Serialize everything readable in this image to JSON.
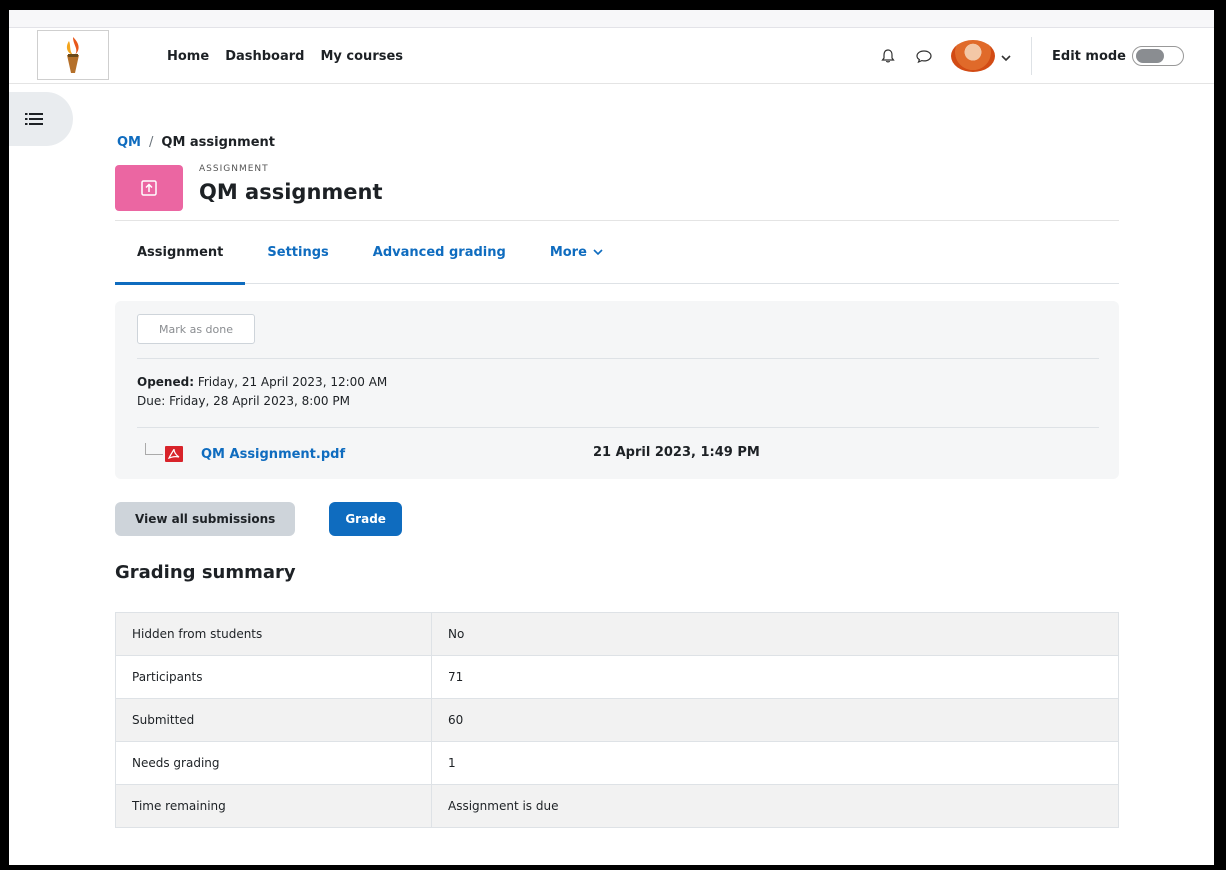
{
  "nav": {
    "links": [
      "Home",
      "Dashboard",
      "My courses"
    ],
    "edit_mode_label": "Edit mode"
  },
  "breadcrumb": {
    "course": "QM",
    "separator": "/",
    "current": "QM assignment"
  },
  "header": {
    "pretitle": "ASSIGNMENT",
    "title": "QM assignment",
    "icon_color": "#eb66a2"
  },
  "tabs": [
    {
      "label": "Assignment",
      "active": true
    },
    {
      "label": "Settings",
      "active": false
    },
    {
      "label": "Advanced grading",
      "active": false
    },
    {
      "label": "More",
      "active": false
    }
  ],
  "activity": {
    "mark_done_label": "Mark as done",
    "opened_label": "Opened:",
    "opened_value": "Friday, 21 April 2023, 12:00 AM",
    "due_label": "Due:",
    "due_value": "Friday, 28 April 2023, 8:00 PM",
    "file_name": "QM Assignment.pdf",
    "file_date": "21 April 2023, 1:49 PM"
  },
  "actions": {
    "view_all_label": "View all submissions",
    "grade_label": "Grade"
  },
  "summary": {
    "title": "Grading summary",
    "rows": [
      {
        "label": "Hidden from students",
        "value": "No"
      },
      {
        "label": "Participants",
        "value": "71"
      },
      {
        "label": "Submitted",
        "value": "60"
      },
      {
        "label": "Needs grading",
        "value": "1"
      },
      {
        "label": "Time remaining",
        "value": "Assignment is due"
      }
    ]
  },
  "colors": {
    "link": "#0f6cbf",
    "primary_button": "#0f6cbf",
    "secondary_button": "#ced4da"
  }
}
